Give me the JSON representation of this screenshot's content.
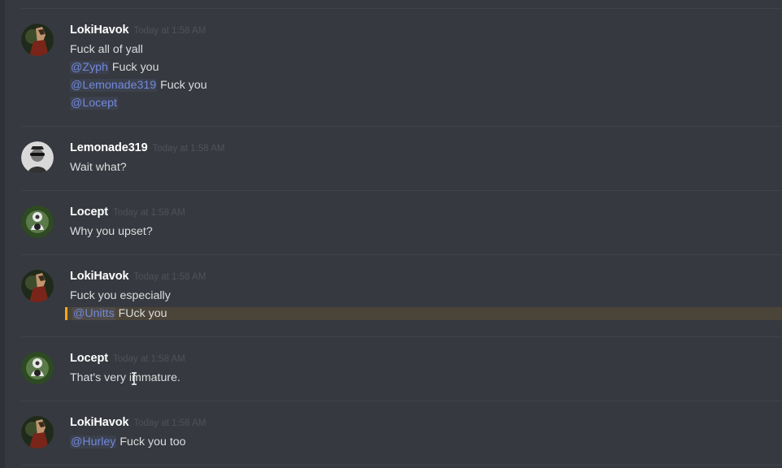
{
  "messages": [
    {
      "username": "LokiHavok",
      "timestamp": "Today at 1:58 AM",
      "avatar": "loki-avatar-icon",
      "lines": [
        {
          "mention": "",
          "text": "Fuck all of yall"
        },
        {
          "mention": "@Zyph",
          "text": " Fuck you"
        },
        {
          "mention": "@Lemonade319",
          "text": " Fuck you"
        },
        {
          "mention": "@Locept",
          "text": ""
        }
      ]
    },
    {
      "username": "Lemonade319",
      "timestamp": "Today at 1:58 AM",
      "avatar": "lemonade-avatar-icon",
      "lines": [
        {
          "mention": "",
          "text": "Wait what?"
        }
      ]
    },
    {
      "username": "Locept",
      "timestamp": "Today at 1:58 AM",
      "avatar": "locept-avatar-icon",
      "lines": [
        {
          "mention": "",
          "text": "Why you upset?"
        }
      ]
    },
    {
      "username": "LokiHavok",
      "timestamp": "Today at 1:58 AM",
      "avatar": "loki-avatar-icon",
      "lines": [
        {
          "mention": "",
          "text": "Fuck you especially"
        },
        {
          "mention": "@Unitts",
          "text": " FUck you",
          "highlight": true
        }
      ]
    },
    {
      "username": "Locept",
      "timestamp": "Today at 1:58 AM",
      "avatar": "locept-avatar-icon",
      "lines": [
        {
          "mention": "",
          "text": "That's very immature."
        }
      ]
    },
    {
      "username": "LokiHavok",
      "timestamp": "Today at 1:58 AM",
      "avatar": "loki-avatar-icon",
      "lines": [
        {
          "mention": "@Hurley",
          "text": " Fuck you too"
        }
      ]
    }
  ],
  "colors": {
    "background": "#36393f",
    "username": "#ffffff",
    "timestamp": "#4f535a",
    "text": "#dcddde",
    "mention": "#7289da",
    "highlight_border": "#faa61a",
    "highlight_bg": "#4a4439"
  }
}
